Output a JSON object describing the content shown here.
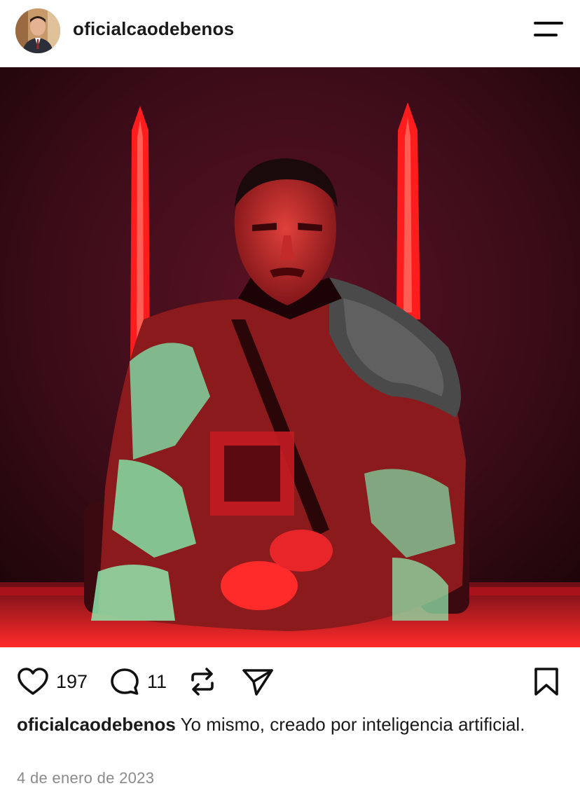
{
  "post": {
    "username": "oficialcaodebenos",
    "likes": "197",
    "comments": "11",
    "caption_user": "oficialcaodebenos",
    "caption_text": " Yo mismo, creado por inteligencia artificial.",
    "date": "4 de enero de 2023"
  },
  "icons": {
    "menu": "menu-icon",
    "like": "heart-icon",
    "comment": "comment-icon",
    "repost": "repost-icon",
    "share": "send-icon",
    "save": "bookmark-icon"
  },
  "colors": {
    "text": "#1a1a1a",
    "date": "#8a8a8a",
    "image_bg": "#3a0c17",
    "image_accent": "#ff2a2a"
  }
}
